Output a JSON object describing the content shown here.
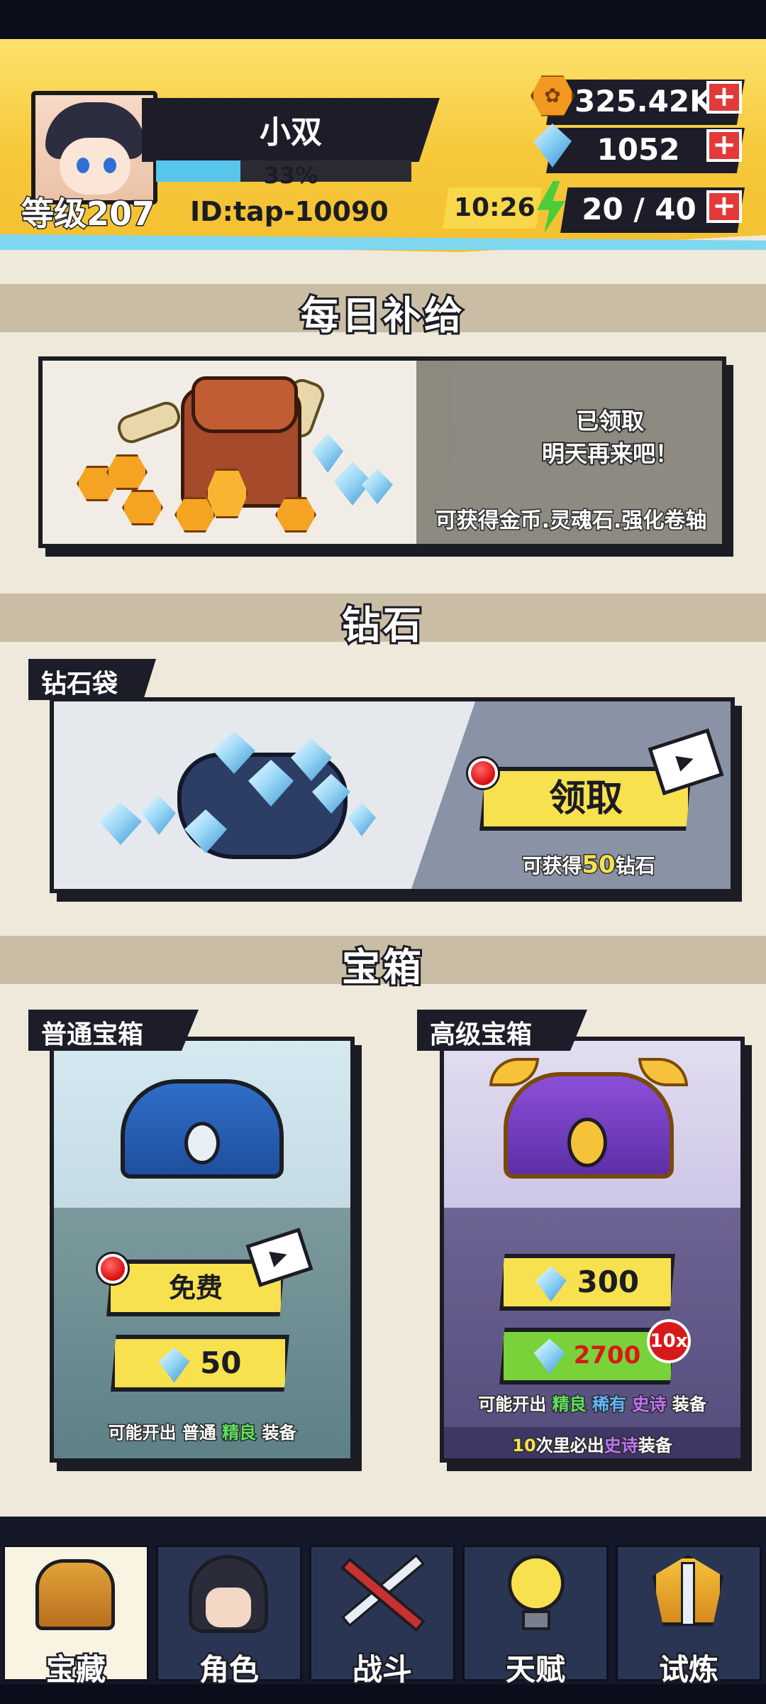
{
  "player": {
    "name": "小双",
    "level_label": "等级207",
    "xp_percent_text": "33%",
    "xp_fraction": 0.33,
    "id_text": "ID:tap-10090"
  },
  "resources": {
    "coins": "325.42K",
    "diamonds": "1052",
    "energy_timer": "10:26",
    "energy": "20 / 40",
    "plus_symbol": "+"
  },
  "daily_supply": {
    "title": "每日补给",
    "status_line1": "已领取",
    "status_line2": "明天再来吧！",
    "description": "可获得金币.灵魂石.强化卷轴"
  },
  "diamond_section": {
    "title": "钻石",
    "tag": "钻石袋",
    "claim_button": "领取",
    "reward_prefix": "可获得",
    "reward_amount": "50",
    "reward_suffix": "钻石"
  },
  "chest_section": {
    "title": "宝箱",
    "normal": {
      "tag": "普通宝箱",
      "free_button": "免费",
      "cost": "50",
      "note_prefix": "可能开出",
      "note_common": "普通",
      "note_fine": "精良",
      "note_suffix": "装备"
    },
    "premium": {
      "tag": "高级宝箱",
      "cost_single": "300",
      "cost_ten": "2700",
      "badge": "10x",
      "note_prefix": "可能开出",
      "note_fine": "精良",
      "note_rare": "稀有",
      "note_epic": "史诗",
      "note_suffix": "装备",
      "guarantee_count": "10",
      "guarantee_mid": "次里必出",
      "guarantee_epic": "史诗",
      "guarantee_suffix": "装备"
    }
  },
  "nav": {
    "tabs": [
      {
        "label": "宝藏",
        "icon": "treasure-chest-icon",
        "active": true
      },
      {
        "label": "角色",
        "icon": "character-icon",
        "active": false
      },
      {
        "label": "战斗",
        "icon": "swords-icon",
        "active": false
      },
      {
        "label": "天赋",
        "icon": "lightbulb-icon",
        "active": false
      },
      {
        "label": "试炼",
        "icon": "trial-emblem-icon",
        "active": false
      }
    ]
  },
  "colors": {
    "header_yellow": "#f6c83a",
    "accent_yellow_button": "#f8e14e",
    "energy_green": "#4ccc3a",
    "plus_red": "#e23a3a",
    "nav_dark": "#141829"
  }
}
